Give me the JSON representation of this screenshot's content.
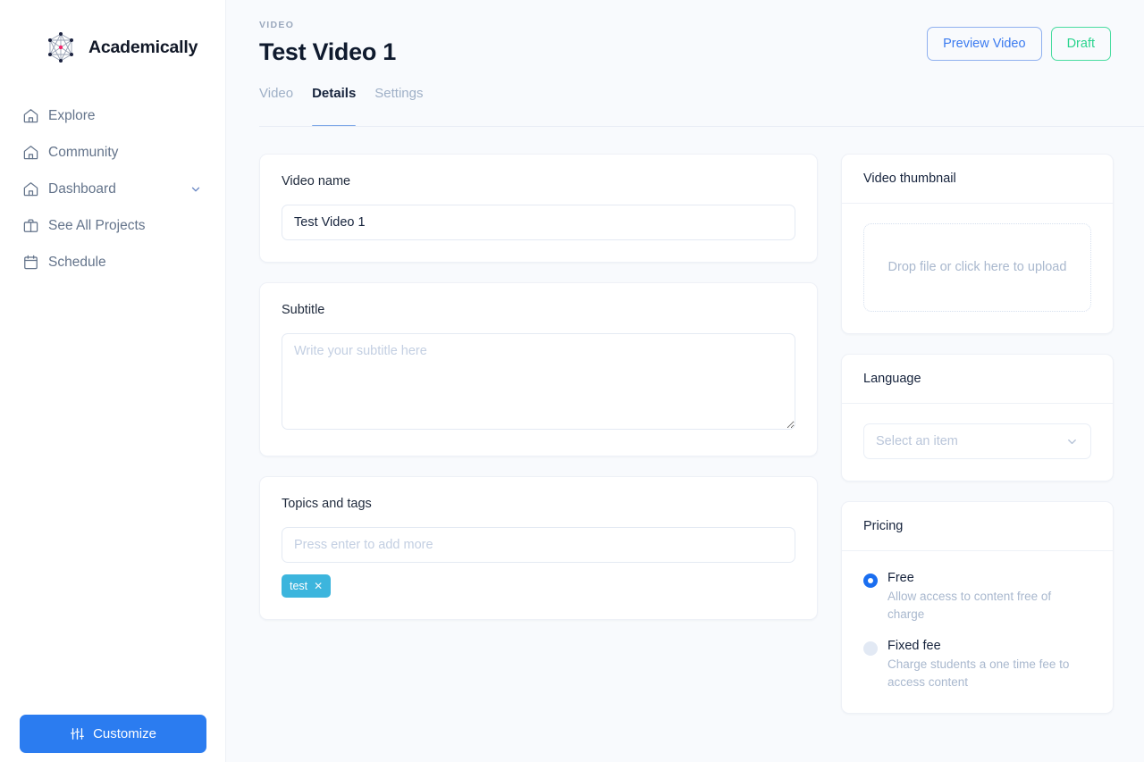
{
  "brand": {
    "name": "Academically",
    "logo_icon": "network-graph-icon"
  },
  "sidebar": {
    "items": [
      {
        "label": "Explore",
        "icon": "home-icon",
        "has_chevron": false
      },
      {
        "label": "Community",
        "icon": "home-icon",
        "has_chevron": false
      },
      {
        "label": "Dashboard",
        "icon": "home-icon",
        "has_chevron": true
      },
      {
        "label": "See All Projects",
        "icon": "briefcase-icon",
        "has_chevron": false
      },
      {
        "label": "Schedule",
        "icon": "calendar-icon",
        "has_chevron": false
      }
    ],
    "customize_label": "Customize",
    "customize_icon": "sliders-icon",
    "customize_color": "#2b7cf0"
  },
  "header": {
    "kicker": "VIDEO",
    "title": "Test Video 1",
    "preview_label": "Preview Video",
    "preview_color": "#3b7bf0",
    "draft_label": "Draft",
    "draft_color": "#2bd48f"
  },
  "tabs": [
    {
      "label": "Video",
      "active": false
    },
    {
      "label": "Details",
      "active": true
    },
    {
      "label": "Settings",
      "active": false
    }
  ],
  "left": {
    "video_name": {
      "label": "Video name",
      "value": "Test Video 1",
      "placeholder": "Video name"
    },
    "subtitle": {
      "label": "Subtitle",
      "value": "",
      "placeholder": "Write your subtitle here"
    },
    "topics": {
      "label": "Topics and tags",
      "placeholder": "Press enter to add more",
      "value": "",
      "tags": [
        {
          "label": "test",
          "remove_icon": "close-icon",
          "color": "#3cb5dd"
        }
      ]
    }
  },
  "right": {
    "thumbnail": {
      "title": "Video thumbnail",
      "dropzone_text": "Drop file or click here to upload"
    },
    "language": {
      "title": "Language",
      "select_placeholder": "Select an item",
      "chevron_icon": "chevron-down-icon"
    },
    "pricing": {
      "title": "Pricing",
      "options": [
        {
          "label": "Free",
          "description": "Allow access to content free of charge",
          "selected": true
        },
        {
          "label": "Fixed fee",
          "description": "Charge students a one time fee to access content",
          "selected": false
        }
      ]
    }
  }
}
